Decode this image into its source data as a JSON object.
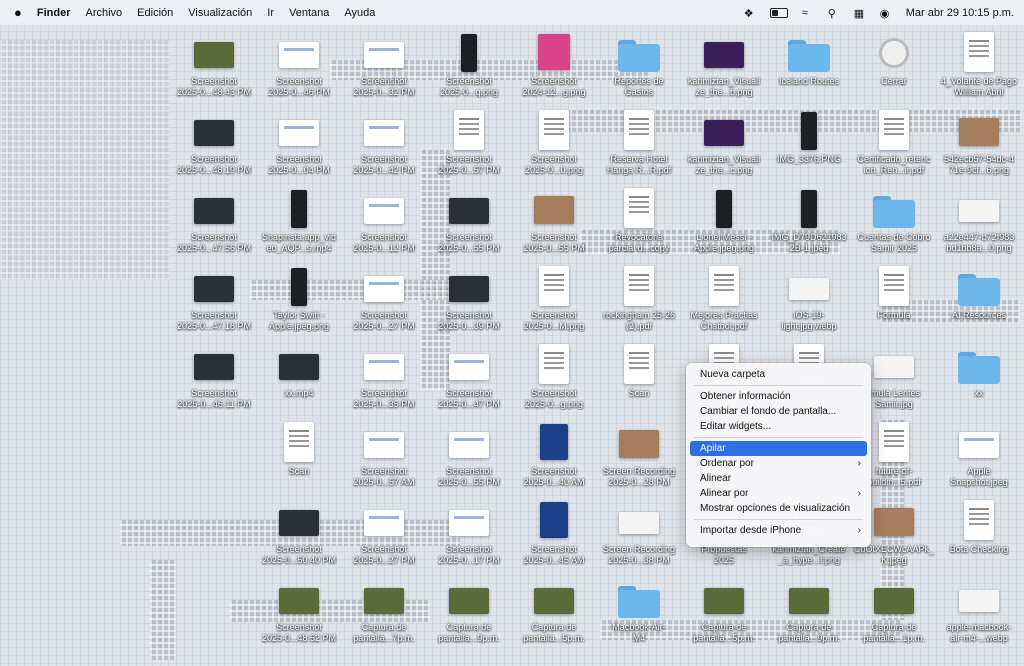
{
  "menubar": {
    "apple": "",
    "items": [
      "Finder",
      "Archivo",
      "Edición",
      "Visualización",
      "Ir",
      "Ventana",
      "Ayuda"
    ],
    "datetime": "Mar abr 29  10:15 p.m."
  },
  "icons": [
    [
      "Screenshot",
      "2025-0...48.43 PM"
    ],
    [
      "Screenshot",
      "2025-0...46 PM"
    ],
    [
      "Screenshot",
      "2025-0...32 PM"
    ],
    [
      "Screenshot",
      "2025-0...q.png"
    ],
    [
      "Screenshot",
      "2024-12...g.png"
    ],
    [
      "Reportes de",
      "Gastos"
    ],
    [
      "karimiztan_Visuali",
      "ze_the...b.png"
    ],
    [
      "Iceland Routes",
      ""
    ],
    [
      "Cerrar",
      ""
    ],
    [
      "4_Volante de Pago",
      "William Abril"
    ],
    [
      "Screenshot",
      "2025-0...48.19 PM"
    ],
    [
      "Screenshot",
      "2025-0...04 PM"
    ],
    [
      "Screenshot",
      "2025-0...42 PM"
    ],
    [
      "Screenshot",
      "2025-0...57 PM"
    ],
    [
      "Screenshot",
      "2025-0...0.png"
    ],
    [
      "Reserva Hotel",
      "Hanga R...R.pdf"
    ],
    [
      "karimiztan_Visuali",
      "ze_the...c.png"
    ],
    [
      "IMG_3376.PNG",
      ""
    ],
    [
      "Certificado_retenc",
      "ion_Ren...ir.pdf"
    ],
    [
      "542ecb57-54dc-4",
      "71e-9cf...6.png"
    ],
    [
      "Screenshot",
      "2025-0...47.56 PM"
    ],
    [
      "Snapinsta.app_vid",
      "eo_AQP...s.mp4"
    ],
    [
      "Screenshot",
      "2025-0...12 PM"
    ],
    [
      "Screenshot",
      "2025-0...55 PM"
    ],
    [
      "Screenshot",
      "2025-0...55 PM"
    ],
    [
      "Revocatoria",
      "parcial d...copy"
    ],
    [
      "Lionel Messi -",
      "Apple.jpeg.png"
    ],
    [
      "IMG_D79D621983",
      "2B-1.jpeg"
    ],
    [
      "Cuentas de Cobro",
      "Samir 2025"
    ],
    [
      "a22e447-b72f983",
      "bd1bb8a...0.png"
    ],
    [
      "Screenshot",
      "2025-0...47.18 PM"
    ],
    [
      "Taylor Swift -",
      "Apple.jpeg.png"
    ],
    [
      "Screenshot",
      "2025-0...27 PM"
    ],
    [
      "Screenshot",
      "2025-0...39 PM"
    ],
    [
      "Screenshot",
      "2025-0...M.png"
    ],
    [
      "rockingham 25-26",
      "(2).pdf"
    ],
    [
      "Mejores Practias",
      "Chatbot.pdf"
    ],
    [
      "iOS-19-",
      "light.jpg.webp"
    ],
    [
      "Formula",
      ""
    ],
    [
      "AI Resources",
      ""
    ],
    [
      "Screenshot",
      "2025-0...46.11 PM"
    ],
    [
      "xx.mp4",
      ""
    ],
    [
      "Screenshot",
      "2025-0...35 PM"
    ],
    [
      "Screenshot",
      "2025-0...47 PM"
    ],
    [
      "Screenshot",
      "2025-0...g.png"
    ],
    [
      "Scan",
      ""
    ],
    [
      "",
      ""
    ],
    [
      "",
      ""
    ],
    [
      "rmula Lentes",
      "Samir.jpg"
    ],
    [
      "xx",
      ""
    ],
    [
      "",
      ""
    ],
    [
      "Scan",
      ""
    ],
    [
      "Screenshot",
      "2025-0...57 AM"
    ],
    [
      "Screenshot",
      "2025-0...55 PM"
    ],
    [
      "Screenshot",
      "2025-0...40 AM"
    ],
    [
      "Screen Recording",
      "2025-0...28 PM"
    ],
    [
      "",
      ""
    ],
    [
      "",
      ""
    ],
    [
      "future-of-",
      "buildin...5.pdf"
    ],
    [
      "Apple",
      "Snapshot.jpeg"
    ],
    [
      "",
      ""
    ],
    [
      "Screenshot",
      "2025-0...50.40 PM"
    ],
    [
      "Screenshot",
      "2025-0...27 PM"
    ],
    [
      "Screenshot",
      "2025-0...17 PM"
    ],
    [
      "Screenshot",
      "2025-0...45 AM"
    ],
    [
      "Screen Recording",
      "2025-0...38 PM"
    ],
    [
      "Propuestas",
      "2025"
    ],
    [
      "karimiztan_Create",
      "_a_hype...f.png"
    ],
    [
      "CbOtXECWcAAPk_",
      "K.jpeg"
    ],
    [
      "Bota Checking",
      ""
    ],
    [
      "",
      ""
    ],
    [
      "Screenshot",
      "2025-0...48.52 PM"
    ],
    [
      "Captura de",
      "pantalla...7p.m."
    ],
    [
      "Captura de",
      "pantalla...9p.m."
    ],
    [
      "Captura de",
      "pantalla...5p.m."
    ],
    [
      "Macbook-Air-",
      "M4"
    ],
    [
      "Captura de",
      "pantalla...5p.m."
    ],
    [
      "Captura de",
      "pantalla...9p.m."
    ],
    [
      "Captura de",
      "pantalla...1p.m."
    ],
    [
      "apple-macbook-",
      "air-m4-...webp"
    ]
  ],
  "context_menu": {
    "new_folder": "Nueva carpeta",
    "get_info": "Obtener información",
    "change_wallpaper": "Cambiar el fondo de pantalla...",
    "edit_widgets": "Editar widgets...",
    "stack": "Apilar",
    "sort_by": "Ordenar por",
    "align": "Alinear",
    "align_by": "Alinear por",
    "view_options": "Mostrar opciones de visualización",
    "import_iphone": "Importar desde iPhone"
  }
}
